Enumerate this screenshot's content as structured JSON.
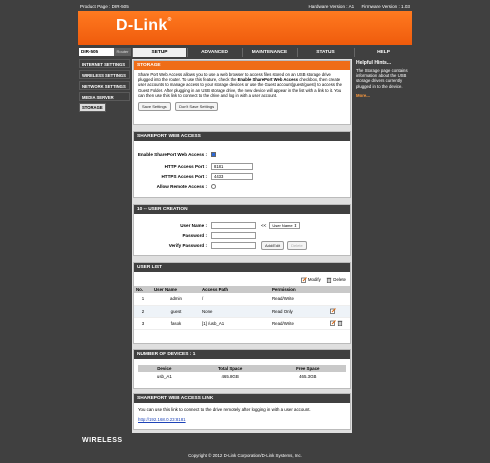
{
  "topbar": {
    "product": "Product Page : DIR-505",
    "hw": "Hardware Version : A1",
    "fw": "Firmware Version : 1.03"
  },
  "brand": {
    "logo": "D-Link",
    "mark": "®",
    "wireless": "WIRELESS"
  },
  "nav": {
    "model": "DIR-505",
    "mode": "Router",
    "tabs": [
      "SETUP",
      "ADVANCED",
      "MAINTENANCE",
      "STATUS",
      "HELP"
    ]
  },
  "sidebar": {
    "items": [
      "INTERNET SETTINGS",
      "WIRELESS SETTINGS",
      "NETWORK SETTINGS",
      "MEDIA SERVER",
      "STORAGE"
    ]
  },
  "storage": {
    "title": "STORAGE",
    "intro_1": "Share Port Web Access allows you to use a web browser to access files stored on an USB storage drive plugged into the router. To use this feature, check the ",
    "intro_bold": "Enable SharePort Web Access",
    "intro_2": " checkbox, then create user accounts to manage access to your storage devices or use the Guest account(guest/guest) to access the Guest Folder. After plugging in an USB storage drive, the new device will appear in the list with a link to it. You can then use this link to connect to the drive and log in with a user account.",
    "save": "Save Settings",
    "dontsave": "Don't Save Settings"
  },
  "swa": {
    "title": "SHAREPORT WEB ACCESS",
    "enable_label": "Enable SharePort Web Access :",
    "http_label": "HTTP Access Port :",
    "http_value": "8181",
    "https_label": "HTTPS Access Port :",
    "https_value": "4433",
    "remote_label": "Allow Remote Access :"
  },
  "creation": {
    "title": "10 -- USER CREATION",
    "user_label": "User Name :",
    "pw_label": "Password :",
    "vpw_label": "Verify Password :",
    "arrow": "<<",
    "select": "User Name",
    "add": "Add/Edit",
    "delete": "Delete"
  },
  "userlist": {
    "title": "USER LIST",
    "modify": "Modify",
    "delete": "Delete",
    "headers": [
      "No.",
      "User Name",
      "Access Path",
      "Permission"
    ],
    "rows": [
      {
        "no": "1",
        "name": "admin",
        "path": "/",
        "perm": "Read/Write"
      },
      {
        "no": "2",
        "name": "guest",
        "path": "None",
        "perm": "Read Only"
      },
      {
        "no": "3",
        "name": "fasok",
        "path": "[1] /usb_A1",
        "perm": "Read/Write"
      }
    ]
  },
  "devices": {
    "title": "NUMBER OF DEVICES : 1",
    "headers": [
      "Device",
      "Total Space",
      "Free Space"
    ],
    "rows": [
      {
        "device": "usb_A1",
        "total": "465.8GB",
        "free": "465.3GB"
      }
    ]
  },
  "link": {
    "title": "SHAREPORT WEB ACCESS LINK",
    "text": "You can use this link to connect to the drive remotely after logging in with a user account.",
    "url": "http://192.168.0.23:8181"
  },
  "hints": {
    "title": "Helpful Hints...",
    "text": "The Storage page contains information about the USB storage drivers currently plugged in to the device.",
    "more": "More..."
  },
  "footer": {
    "copyright": "Copyright © 2012 D-Link Corporation/D-Link Systems, Inc."
  }
}
